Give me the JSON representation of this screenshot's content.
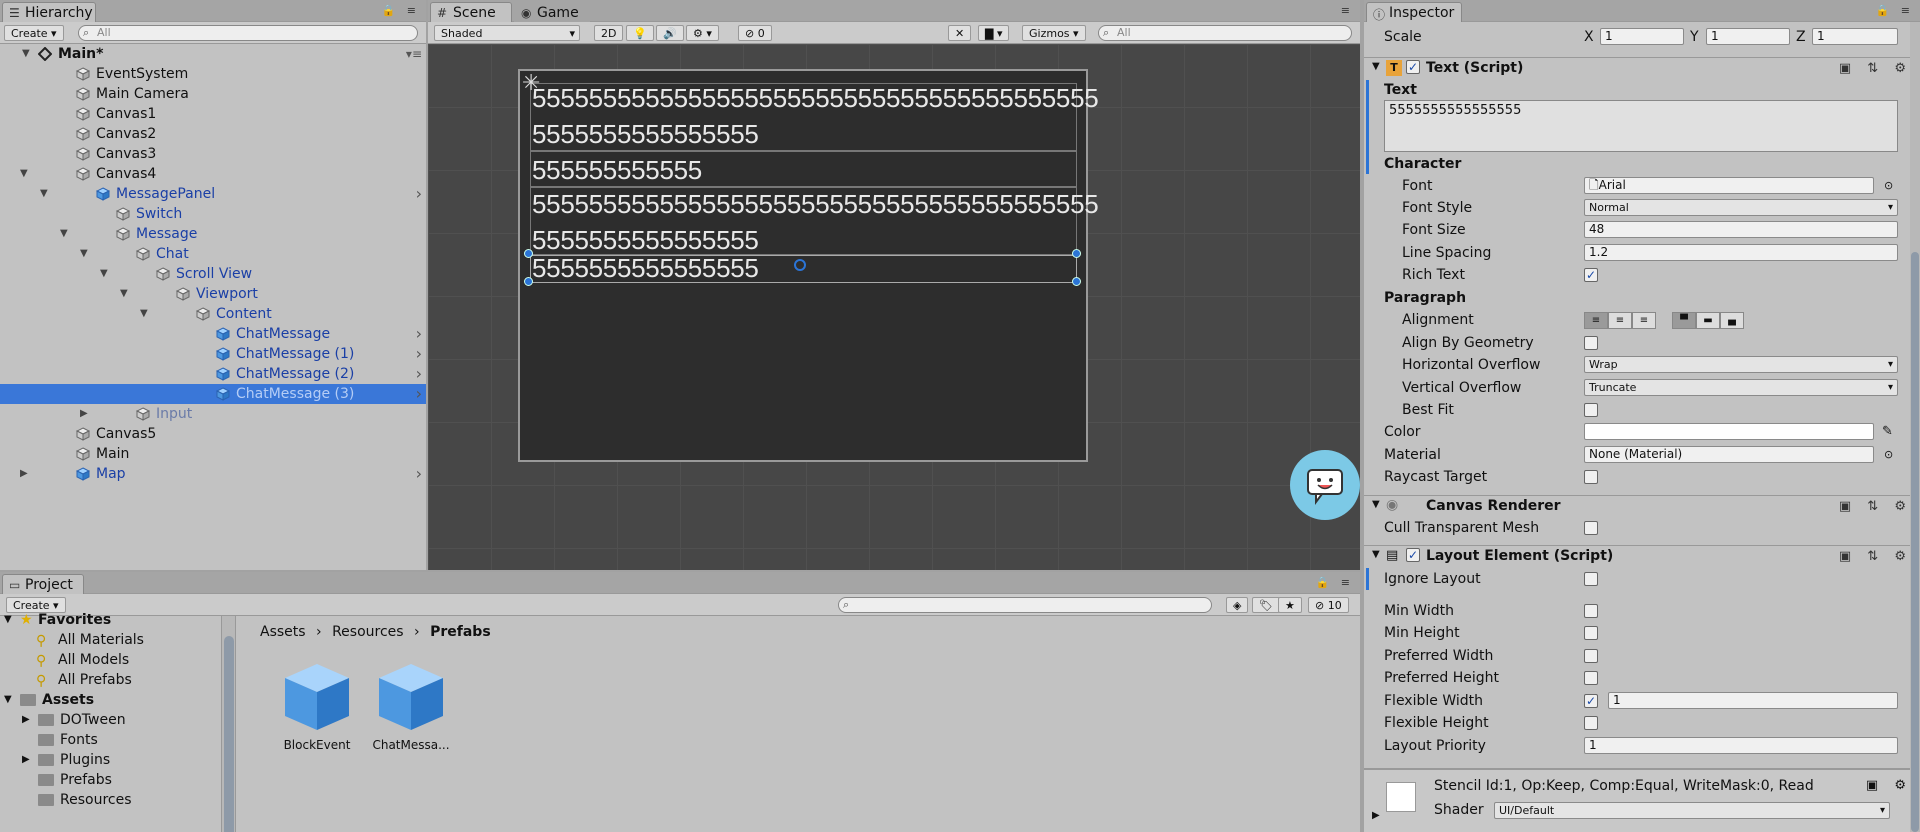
{
  "hierarchy": {
    "tab_label": "Hierarchy",
    "create_label": "Create",
    "search_placeholder": "All",
    "root": "Main*",
    "items": [
      {
        "label": "EventSystem"
      },
      {
        "label": "Main Camera"
      },
      {
        "label": "Canvas1"
      },
      {
        "label": "Canvas2"
      },
      {
        "label": "Canvas3"
      },
      {
        "label": "Canvas4"
      },
      {
        "label": "MessagePanel"
      },
      {
        "label": "Switch"
      },
      {
        "label": "Message"
      },
      {
        "label": "Chat"
      },
      {
        "label": "Scroll View"
      },
      {
        "label": "Viewport"
      },
      {
        "label": "Content"
      },
      {
        "label": "ChatMessage"
      },
      {
        "label": "ChatMessage (1)"
      },
      {
        "label": "ChatMessage (2)"
      },
      {
        "label": "ChatMessage (3)"
      },
      {
        "label": "Input"
      },
      {
        "label": "Canvas5"
      },
      {
        "label": "Main"
      },
      {
        "label": "Map"
      }
    ]
  },
  "scene": {
    "tabs": {
      "scene": "Scene",
      "game": "Game"
    },
    "shading": "Shaded",
    "mode_2d": "2D",
    "hidden_count": "0",
    "gizmos": "Gizmos",
    "search_placeholder": "All",
    "lines": [
      "5555555555555555555555555555555555555555",
      "5555555555555555",
      "555555555555",
      "5555555555555555555555555555555555555555",
      "5555555555555555",
      "5555555555555555"
    ]
  },
  "inspector": {
    "tab_label": "Inspector",
    "scale": {
      "label": "Scale",
      "x_label": "X",
      "x": "1",
      "y_label": "Y",
      "y": "1",
      "z_label": "Z",
      "z": "1"
    },
    "text_script": {
      "title": "Text (Script)",
      "text_label": "Text",
      "text_value": "5555555555555555",
      "character_label": "Character",
      "font_label": "Font",
      "font_value": "Arial",
      "font_style_label": "Font Style",
      "font_style_value": "Normal",
      "font_size_label": "Font Size",
      "font_size_value": "48",
      "line_spacing_label": "Line Spacing",
      "line_spacing_value": "1.2",
      "rich_text_label": "Rich Text",
      "paragraph_label": "Paragraph",
      "alignment_label": "Alignment",
      "align_by_geometry_label": "Align By Geometry",
      "h_overflow_label": "Horizontal Overflow",
      "h_overflow_value": "Wrap",
      "v_overflow_label": "Vertical Overflow",
      "v_overflow_value": "Truncate",
      "best_fit_label": "Best Fit",
      "color_label": "Color",
      "material_label": "Material",
      "material_value": "None (Material)",
      "raycast_label": "Raycast Target"
    },
    "canvas_renderer": {
      "title": "Canvas Renderer",
      "cull_label": "Cull Transparent Mesh"
    },
    "layout_element": {
      "title": "Layout Element (Script)",
      "ignore_layout": "Ignore Layout",
      "min_width": "Min Width",
      "min_height": "Min Height",
      "preferred_width": "Preferred Width",
      "preferred_height": "Preferred Height",
      "flexible_width": "Flexible Width",
      "flexible_width_value": "1",
      "flexible_height": "Flexible Height",
      "layout_priority": "Layout Priority",
      "layout_priority_value": "1"
    },
    "material_footer": {
      "stencil": "Stencil Id:1, Op:Keep, Comp:Equal, WriteMask:0, Read",
      "shader_label": "Shader",
      "shader_value": "UI/Default"
    }
  },
  "project": {
    "tab_label": "Project",
    "create_label": "Create",
    "hidden_count": "10",
    "favorites_label": "Favorites",
    "favorites": [
      "All Materials",
      "All Models",
      "All Prefabs"
    ],
    "assets_label": "Assets",
    "folders": [
      "DOTween",
      "Fonts",
      "Plugins",
      "Prefabs",
      "Resources"
    ],
    "breadcrumb": [
      "Assets",
      "Resources",
      "Prefabs"
    ],
    "assets": [
      "BlockEvent",
      "ChatMessa..."
    ]
  },
  "colors": {
    "selection": "#3a77d8",
    "prefab_text": "#1a3fa6",
    "scene_bg": "#474747"
  }
}
